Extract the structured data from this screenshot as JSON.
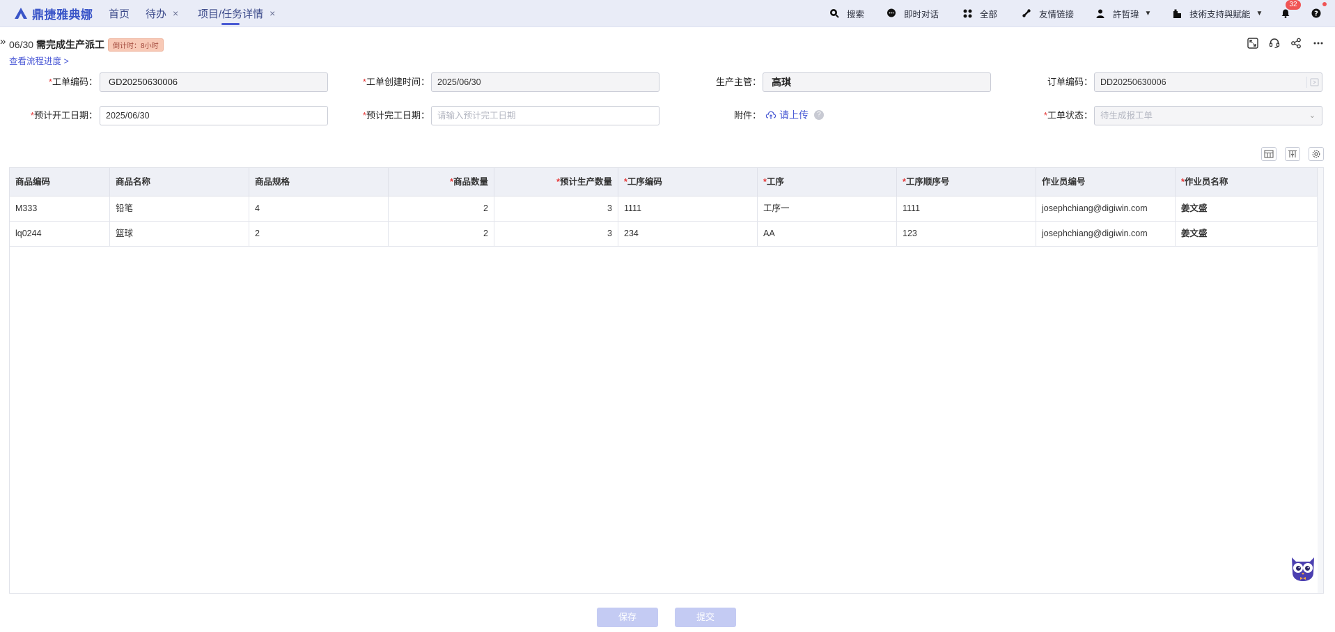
{
  "app": {
    "logo_text": "鼎捷雅典娜"
  },
  "nav": {
    "tabs": [
      {
        "label": "首页"
      },
      {
        "label": "待办"
      },
      {
        "label": "项目/任务详情"
      }
    ],
    "close_glyph": "×"
  },
  "topbar": {
    "search": "搜索",
    "chat": "即时对话",
    "all": "全部",
    "links": "友情链接",
    "user": "許哲瑋",
    "org": "技術支持與賦能",
    "notifications": "32"
  },
  "header": {
    "date": "06/30",
    "title": "需完成生产派工",
    "countdown": "倒计时：8小时",
    "progress_link": "查看流程进度 >"
  },
  "form": {
    "work_order_no": {
      "label": "工单编码",
      "value": "GD20250630006"
    },
    "created_time": {
      "label": "工单创建时间",
      "value": "2025/06/30"
    },
    "supervisor": {
      "label": "生产主管",
      "value": "高琪"
    },
    "order_no": {
      "label": "订单编码",
      "value": "DD20250630006"
    },
    "planned_start": {
      "label": "预计开工日期",
      "value": "2025/06/30"
    },
    "planned_end": {
      "label": "预计完工日期",
      "placeholder": "请输入预计完工日期"
    },
    "attachment": {
      "label": "附件",
      "upload_label": "请上传"
    },
    "status": {
      "label": "工单状态",
      "value": "待生成报工单"
    },
    "colon": "："
  },
  "table": {
    "columns": [
      {
        "label": "商品编码",
        "required": false
      },
      {
        "label": "商品名称",
        "required": false
      },
      {
        "label": "商品规格",
        "required": false
      },
      {
        "label": "商品数量",
        "required": true
      },
      {
        "label": "预计生产数量",
        "required": true
      },
      {
        "label": "工序编码",
        "required": true
      },
      {
        "label": "工序",
        "required": true
      },
      {
        "label": "工序顺序号",
        "required": true
      },
      {
        "label": "作业员编号",
        "required": false
      },
      {
        "label": "作业员名称",
        "required": true
      }
    ],
    "rows": [
      [
        "M333",
        "铅笔",
        "4",
        "2",
        "3",
        "1111",
        "工序一",
        "1111",
        "josephchiang@digiwin.com",
        "姜文盛"
      ],
      [
        "lq0244",
        "篮球",
        "2",
        "2",
        "3",
        "234",
        "AA",
        "123",
        "josephchiang@digiwin.com",
        "姜文盛"
      ]
    ]
  },
  "actions": {
    "save": "保存",
    "submit": "提交"
  },
  "colors": {
    "accent": "#4a5bd4",
    "required": "#e53838",
    "badge": "#f05454"
  }
}
